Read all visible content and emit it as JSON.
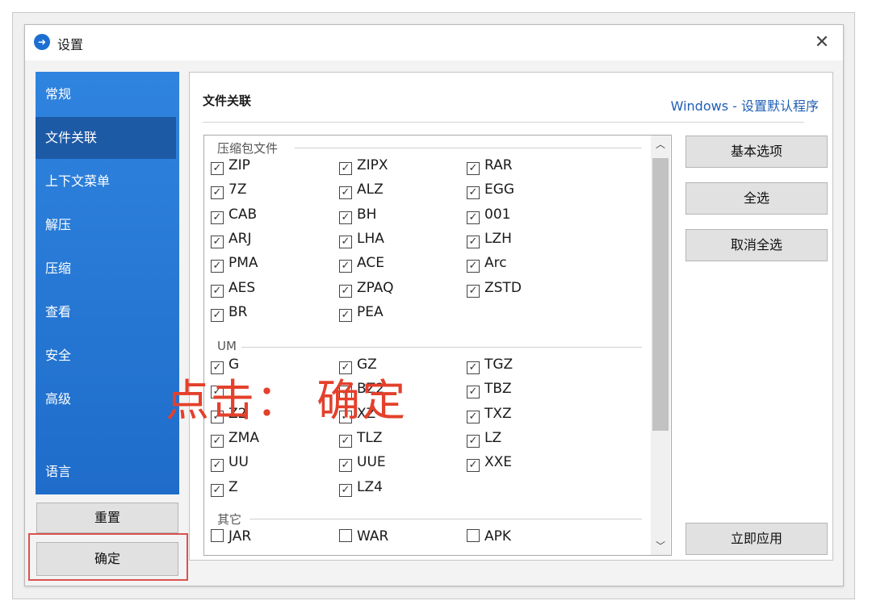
{
  "window": {
    "title": "设置",
    "close_glyph": "✕"
  },
  "sidebar": {
    "items": [
      {
        "label": "常规"
      },
      {
        "label": "文件关联"
      },
      {
        "label": "上下文菜单"
      },
      {
        "label": "解压"
      },
      {
        "label": "压缩"
      },
      {
        "label": "查看"
      },
      {
        "label": "安全"
      },
      {
        "label": "高级"
      },
      {
        "label": "语言"
      }
    ],
    "active": "文件关联"
  },
  "footer": {
    "reset_label": "重置",
    "ok_label": "确定"
  },
  "panel": {
    "heading": "文件关联",
    "link": "Windows - 设置默认程序"
  },
  "groups": [
    {
      "title": "压缩包文件",
      "items": [
        {
          "label": "ZIP",
          "checked": true
        },
        {
          "label": "ZIPX",
          "checked": true
        },
        {
          "label": "RAR",
          "checked": true
        },
        {
          "label": "7Z",
          "checked": true
        },
        {
          "label": "ALZ",
          "checked": true
        },
        {
          "label": "EGG",
          "checked": true
        },
        {
          "label": "CAB",
          "checked": true
        },
        {
          "label": "BH",
          "checked": true
        },
        {
          "label": "001",
          "checked": true
        },
        {
          "label": "ARJ",
          "checked": true
        },
        {
          "label": "LHA",
          "checked": true
        },
        {
          "label": "LZH",
          "checked": true
        },
        {
          "label": "PMA",
          "checked": true
        },
        {
          "label": "ACE",
          "checked": true
        },
        {
          "label": "Arc",
          "checked": true
        },
        {
          "label": "AES",
          "checked": true
        },
        {
          "label": "ZPAQ",
          "checked": true
        },
        {
          "label": "ZSTD",
          "checked": true
        },
        {
          "label": "BR",
          "checked": true
        },
        {
          "label": "PEA",
          "checked": true
        }
      ]
    },
    {
      "title": "UM",
      "items": [
        {
          "label": "G",
          "checked": true
        },
        {
          "label": "GZ",
          "checked": true
        },
        {
          "label": "TGZ",
          "checked": true
        },
        {
          "label": "",
          "checked": true
        },
        {
          "label": "BZ2",
          "checked": true
        },
        {
          "label": "TBZ",
          "checked": true
        },
        {
          "label": "Z2",
          "checked": true
        },
        {
          "label": "XZ",
          "checked": true
        },
        {
          "label": "TXZ",
          "checked": true
        },
        {
          "label": "ZMA",
          "checked": true
        },
        {
          "label": "TLZ",
          "checked": true
        },
        {
          "label": "LZ",
          "checked": true
        },
        {
          "label": "UU",
          "checked": true
        },
        {
          "label": "UUE",
          "checked": true
        },
        {
          "label": "XXE",
          "checked": true
        },
        {
          "label": "Z",
          "checked": true
        },
        {
          "label": "LZ4",
          "checked": true
        }
      ]
    },
    {
      "title": "其它",
      "items": [
        {
          "label": "JAR",
          "checked": false
        },
        {
          "label": "WAR",
          "checked": false
        },
        {
          "label": "APK",
          "checked": false
        }
      ]
    }
  ],
  "right_buttons": {
    "basic": "基本选项",
    "select_all": "全选",
    "deselect_all": "取消全选",
    "apply": "立即应用"
  },
  "overlay_text": "点击： 确定",
  "colors": {
    "sidebar": "#2a7cda",
    "sidebar_active": "#1d5aa6",
    "overlay": "#e4402b",
    "link": "#1f5fb5"
  }
}
